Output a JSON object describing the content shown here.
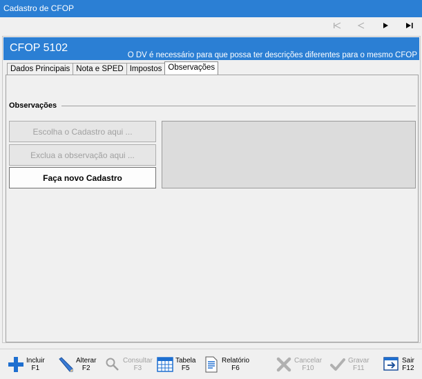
{
  "window": {
    "title": "Cadastro de CFOP"
  },
  "header": {
    "cfop": "CFOP 5102",
    "note": "O DV é necessário para que possa ter descrições diferentes para o mesmo CFOP"
  },
  "tabs": [
    {
      "label": "Dados Principais"
    },
    {
      "label": "Nota e SPED"
    },
    {
      "label": "Impostos"
    },
    {
      "label": "Observações"
    }
  ],
  "observacoes": {
    "section_label": "Observações",
    "choose_button": "Escolha o Cadastro aqui ...",
    "delete_button": "Exclua a observação aqui ...",
    "new_button": "Faça novo Cadastro"
  },
  "toolbar": {
    "incluir": {
      "label": "Incluir",
      "key": "F1"
    },
    "alterar": {
      "label": "Alterar",
      "key": "F2"
    },
    "consultar": {
      "label": "Consultar",
      "key": "F3"
    },
    "tabela": {
      "label": "Tabela",
      "key": "F5"
    },
    "relatorio": {
      "label": "Relatório",
      "key": "F6"
    },
    "cancelar": {
      "label": "Cancelar",
      "key": "F10"
    },
    "gravar": {
      "label": "Gravar",
      "key": "F11"
    },
    "sair": {
      "label": "Sair",
      "key": "F12"
    }
  },
  "colors": {
    "accent": "#2b7fd4",
    "disabled_text": "#a0a0a0"
  }
}
